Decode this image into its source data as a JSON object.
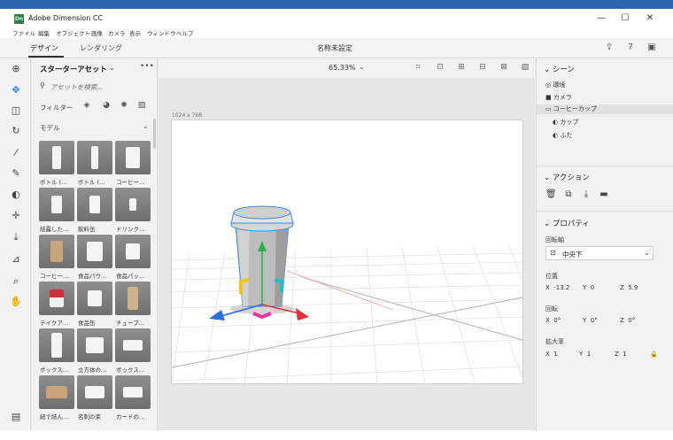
{
  "window": {
    "title": "Adobe Dimension CC",
    "app_badge": "Dn",
    "controls": {
      "minimize": "—",
      "maximize": "☐",
      "close": "✕"
    }
  },
  "menu": [
    "ファイル",
    "編集",
    "オブジェクト",
    "画像",
    "カメラ",
    "表示",
    "ウィンドウ",
    "ヘルプ"
  ],
  "topbar": {
    "tabs": [
      {
        "label": "デザイン",
        "active": true
      },
      {
        "label": "レンダリング",
        "active": false
      }
    ],
    "doc_title": "名称未設定"
  },
  "tools": [
    "add-icon",
    "select-icon",
    "selection-tool-icon",
    "rotate-icon",
    "magic-wand-icon",
    "eyedropper-icon",
    "paint-icon",
    "move-icon",
    "drop-icon",
    "measure-icon",
    "zoom-icon",
    "pan-icon",
    "library-icon"
  ],
  "assets": {
    "title": "スターターアセット",
    "more": "•••",
    "search_placeholder": "アセットを検索...",
    "filter_label": "フィルター",
    "section_label": "モデル",
    "items": [
      {
        "label": "ボトル (…",
        "shape": "bottle"
      },
      {
        "label": "ボトル (…",
        "shape": "bottle2"
      },
      {
        "label": "コーヒー…",
        "shape": "cup"
      },
      {
        "label": "結露した…",
        "shape": "can"
      },
      {
        "label": "飲料缶",
        "shape": "can"
      },
      {
        "label": "ドリンク…",
        "shape": "small"
      },
      {
        "label": "コーヒー…",
        "shape": "bag"
      },
      {
        "label": "食品パウ…",
        "shape": "pouch"
      },
      {
        "label": "食品パッ…",
        "shape": "pack"
      },
      {
        "label": "テイクア…",
        "shape": "cupred"
      },
      {
        "label": "食品缶",
        "shape": "tin"
      },
      {
        "label": "チューブ…",
        "shape": "tube"
      },
      {
        "label": "ボックス…",
        "shape": "tallbox"
      },
      {
        "label": "立方体の…",
        "shape": "cube"
      },
      {
        "label": "ボックス…",
        "shape": "flatbox"
      },
      {
        "label": "紐で結ん…",
        "shape": "parcel"
      },
      {
        "label": "名刺の束",
        "shape": "cards"
      },
      {
        "label": "カードの…",
        "shape": "cards2"
      }
    ]
  },
  "viewport": {
    "zoom": "65.33%",
    "canvas_size": "1024 x 768"
  },
  "scene": {
    "title": "シーン",
    "items": [
      {
        "label": "環境",
        "icon": "environment-icon",
        "selected": false,
        "indent": 0
      },
      {
        "label": "カメラ",
        "icon": "camera-icon",
        "selected": false,
        "indent": 0
      },
      {
        "label": "コーヒーカップ",
        "icon": "folder-icon",
        "selected": true,
        "indent": 0
      },
      {
        "label": "カップ",
        "icon": "material-icon",
        "selected": false,
        "indent": 1
      },
      {
        "label": "ふた",
        "icon": "material-icon",
        "selected": false,
        "indent": 1
      }
    ]
  },
  "actions": {
    "title": "アクション",
    "icons": [
      "delete-icon",
      "duplicate-icon",
      "download-icon",
      "folder-icon"
    ]
  },
  "properties": {
    "title": "プロパティ",
    "pivot_label": "回転軸",
    "pivot_value": "中央下",
    "position_label": "位置",
    "position": {
      "x": "-13.2",
      "y": "0",
      "z": "5.9"
    },
    "rotation_label": "回転",
    "rotation": {
      "x": "0°",
      "y": "0°",
      "z": "0°"
    },
    "scale_label": "拡大率",
    "scale": {
      "x": "1",
      "y": "1",
      "z": "1"
    },
    "axis_x": "X",
    "axis_y": "Y",
    "axis_z": "Z"
  },
  "colors": {
    "accent": "#2a7fde",
    "title_bar": "#2b64b0",
    "gizmo_x": "#e0323c",
    "gizmo_y": "#2bb34a",
    "gizmo_z": "#2a6fe0"
  }
}
